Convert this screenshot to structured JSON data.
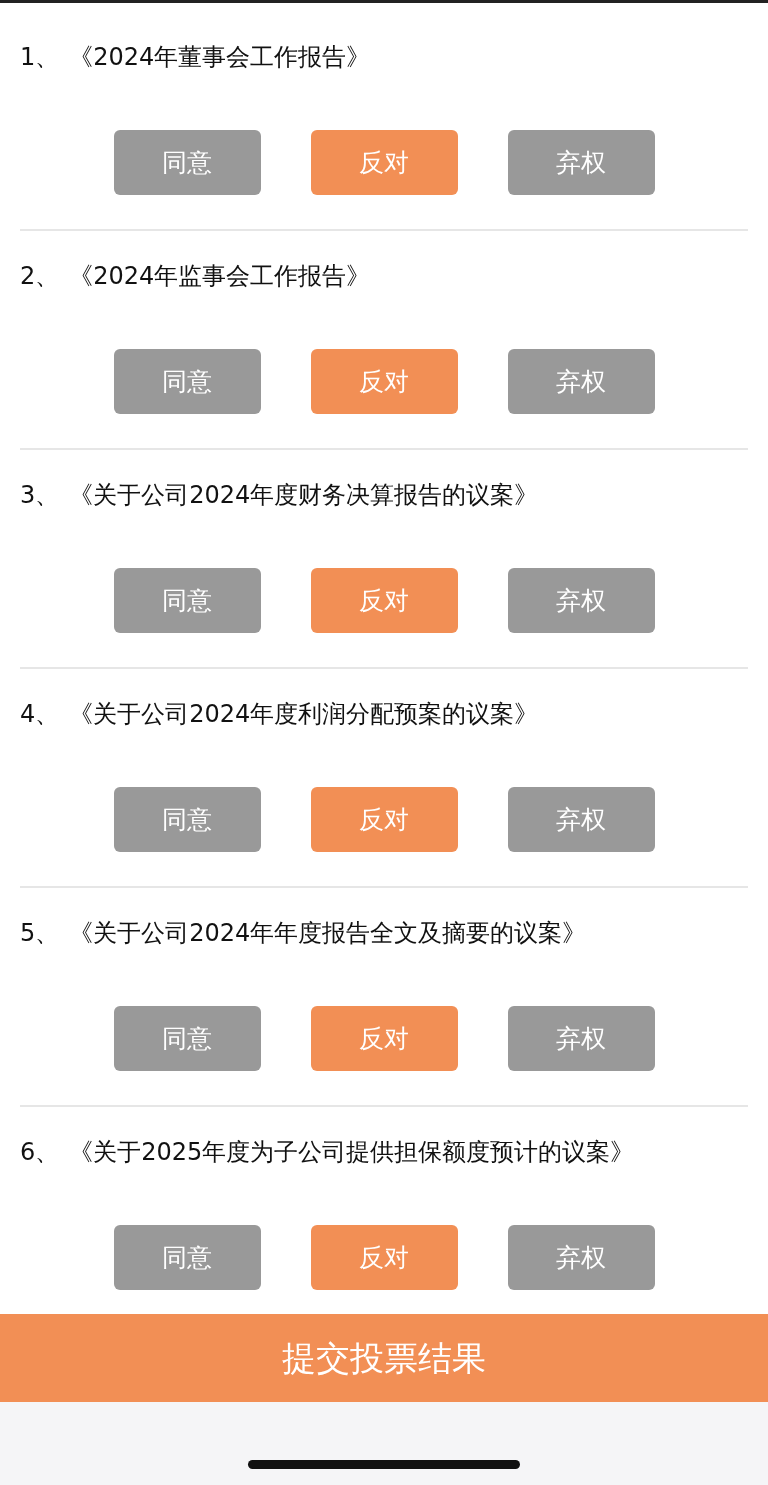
{
  "motions": [
    {
      "number": "1、",
      "title": "《2024年董事会工作报告》",
      "options": [
        {
          "label": "同意",
          "selected": false
        },
        {
          "label": "反对",
          "selected": true
        },
        {
          "label": "弃权",
          "selected": false
        }
      ]
    },
    {
      "number": "2、",
      "title": "《2024年监事会工作报告》",
      "options": [
        {
          "label": "同意",
          "selected": false
        },
        {
          "label": "反对",
          "selected": true
        },
        {
          "label": "弃权",
          "selected": false
        }
      ]
    },
    {
      "number": "3、",
      "title": "《关于公司2024年度财务决算报告的议案》",
      "options": [
        {
          "label": "同意",
          "selected": false
        },
        {
          "label": "反对",
          "selected": true
        },
        {
          "label": "弃权",
          "selected": false
        }
      ]
    },
    {
      "number": "4、",
      "title": "《关于公司2024年度利润分配预案的议案》",
      "options": [
        {
          "label": "同意",
          "selected": false
        },
        {
          "label": "反对",
          "selected": true
        },
        {
          "label": "弃权",
          "selected": false
        }
      ]
    },
    {
      "number": "5、",
      "title": "《关于公司2024年年度报告全文及摘要的议案》",
      "options": [
        {
          "label": "同意",
          "selected": false
        },
        {
          "label": "反对",
          "selected": true
        },
        {
          "label": "弃权",
          "selected": false
        }
      ]
    },
    {
      "number": "6、",
      "title": "《关于2025年度为子公司提供担保额度预计的议案》",
      "options": [
        {
          "label": "同意",
          "selected": false
        },
        {
          "label": "反对",
          "selected": true
        },
        {
          "label": "弃权",
          "selected": false
        }
      ]
    }
  ],
  "submit_button": "提交投票结果"
}
